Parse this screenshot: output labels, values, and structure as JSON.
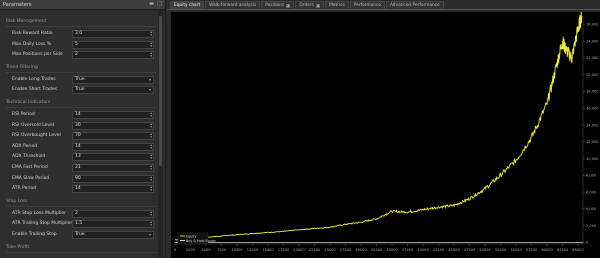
{
  "panel": {
    "title": "Parameters"
  },
  "sections": [
    {
      "title": "Risk Management",
      "params": [
        {
          "label": "Risk Reward Ratio",
          "value": "3.0",
          "control": "spin"
        },
        {
          "label": "Max Daily Loss %",
          "value": "5",
          "control": "spin"
        },
        {
          "label": "Max Positions per Side",
          "value": "2",
          "control": "spin"
        }
      ]
    },
    {
      "title": "Trend Filtering",
      "params": [
        {
          "label": "Enable Long Trades",
          "value": "True",
          "control": "drop"
        },
        {
          "label": "Enable Short Trades",
          "value": "True",
          "control": "drop"
        }
      ]
    },
    {
      "title": "Technical Indicators",
      "params": [
        {
          "label": "RSI Period",
          "value": "14",
          "control": "spin"
        },
        {
          "label": "RSI Oversold Level",
          "value": "30",
          "control": "spin"
        },
        {
          "label": "RSI Overbought Level",
          "value": "70",
          "control": "spin"
        },
        {
          "label": "ADX Period",
          "value": "14",
          "control": "spin"
        },
        {
          "label": "ADX Threshold",
          "value": "13",
          "control": "spin"
        },
        {
          "label": "EMA Fast Period",
          "value": "21",
          "control": "spin"
        },
        {
          "label": "EMA Slow Period",
          "value": "90",
          "control": "spin"
        },
        {
          "label": "ATR Period",
          "value": "14",
          "control": "spin"
        }
      ]
    },
    {
      "title": "Stop Loss",
      "params": [
        {
          "label": "ATR Stop Loss Multiplier",
          "value": "2",
          "control": "spin"
        },
        {
          "label": "ATR Trailing Stop Multiplier",
          "value": "1.5",
          "control": "spin"
        },
        {
          "label": "Enable Trailing Stop",
          "value": "True",
          "control": "drop"
        }
      ]
    },
    {
      "title": "Take Profit",
      "params": []
    }
  ],
  "tabs": [
    {
      "label": "Equity chart",
      "active": true
    },
    {
      "label": "Walk-forward analysis",
      "active": false
    },
    {
      "label": "Positions",
      "count": "2",
      "active": false
    },
    {
      "label": "Orders",
      "count": "4",
      "active": false
    },
    {
      "label": "Metrics",
      "active": false
    },
    {
      "label": "Performance",
      "active": false
    },
    {
      "label": "Advanced Performance",
      "active": false
    }
  ],
  "chart_data": {
    "type": "line",
    "series": [
      {
        "name": "Equity",
        "color": "#e8e84a"
      },
      {
        "name": "Buy & Hold Equity",
        "color": "#ffffff"
      }
    ],
    "x_ticks": [
      "0",
      "2500",
      "5000",
      "7500",
      "10000",
      "12500",
      "15000",
      "17500",
      "20000",
      "22500",
      "25000",
      "27500",
      "30000",
      "32500",
      "35000",
      "37500",
      "40000",
      "42500",
      "45000",
      "47500",
      "50000",
      "52500",
      "55000",
      "57500",
      "60000",
      "62500",
      "65000"
    ],
    "y_ticks": [
      "0",
      "2,000",
      "4,000",
      "6,000",
      "8,000",
      "10,000",
      "12,000",
      "14,000",
      "16,000",
      "18,000",
      "20,000",
      "22,000",
      "24,000",
      "26,000"
    ],
    "xlim": [
      0,
      65800
    ],
    "ylim": [
      -200,
      27000
    ],
    "grid": false,
    "legend": "bottom-left",
    "equity_points": [
      [
        0,
        300
      ],
      [
        2500,
        450
      ],
      [
        5000,
        600
      ],
      [
        7500,
        750
      ],
      [
        10000,
        900
      ],
      [
        12500,
        1050
      ],
      [
        15000,
        1180
      ],
      [
        17500,
        1300
      ],
      [
        20000,
        1500
      ],
      [
        22500,
        1650
      ],
      [
        25000,
        1800
      ],
      [
        27500,
        2150
      ],
      [
        30000,
        2400
      ],
      [
        32500,
        2800
      ],
      [
        35000,
        3700
      ],
      [
        37500,
        3600
      ],
      [
        40000,
        3900
      ],
      [
        42500,
        4200
      ],
      [
        45000,
        4400
      ],
      [
        47500,
        5200
      ],
      [
        50000,
        6400
      ],
      [
        52500,
        8000
      ],
      [
        55000,
        9800
      ],
      [
        57500,
        12500
      ],
      [
        60000,
        16500
      ],
      [
        61500,
        21000
      ],
      [
        62500,
        24000
      ],
      [
        63000,
        23000
      ],
      [
        64000,
        22000
      ],
      [
        65000,
        25500
      ],
      [
        65600,
        27000
      ]
    ]
  }
}
